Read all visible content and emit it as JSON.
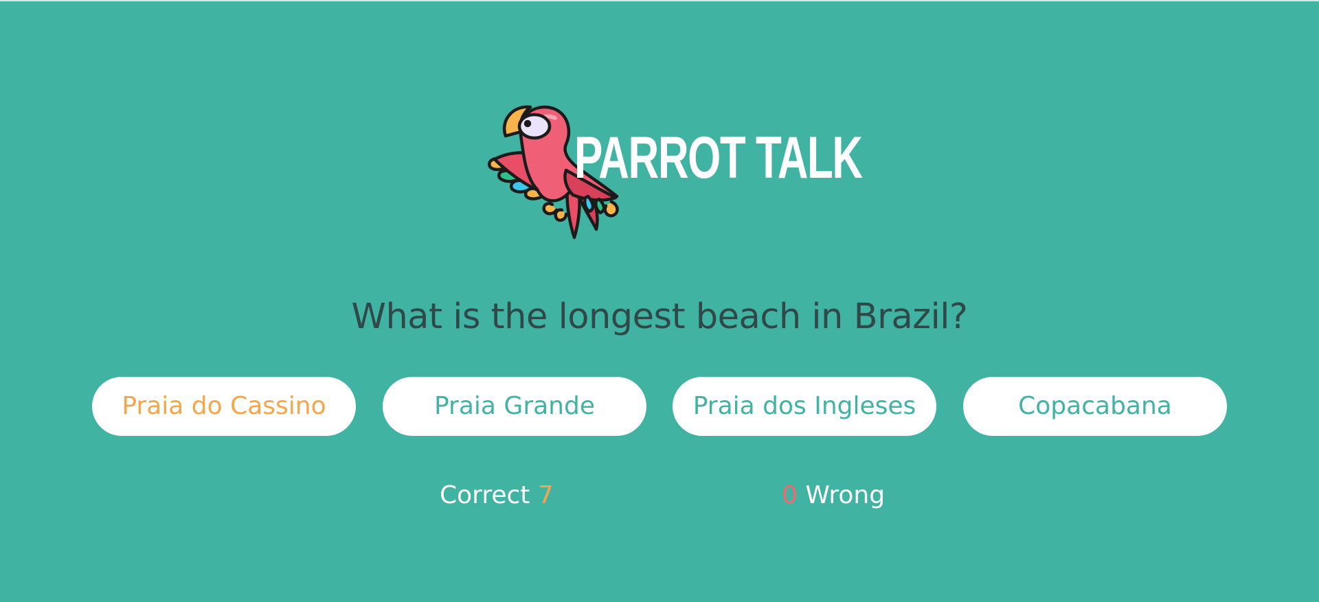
{
  "app": {
    "title": "PARROT TALK",
    "logo_icon": "parrot-logo-icon"
  },
  "quiz": {
    "question": "What is the longest beach in Brazil?",
    "answers": [
      {
        "label": "Praia do Cassino",
        "highlighted": true
      },
      {
        "label": "Praia Grande",
        "highlighted": false
      },
      {
        "label": "Praia dos Ingleses",
        "highlighted": false
      },
      {
        "label": "Copacabana",
        "highlighted": false
      }
    ]
  },
  "score": {
    "correct_label": "Correct",
    "correct_count": "7",
    "wrong_count": "0",
    "wrong_label": "Wrong"
  },
  "colors": {
    "background": "#41b3a2",
    "accent_orange": "#f7a54a",
    "accent_red": "#f06b6d",
    "button_bg": "#ffffff",
    "question_text": "#2f4848"
  }
}
